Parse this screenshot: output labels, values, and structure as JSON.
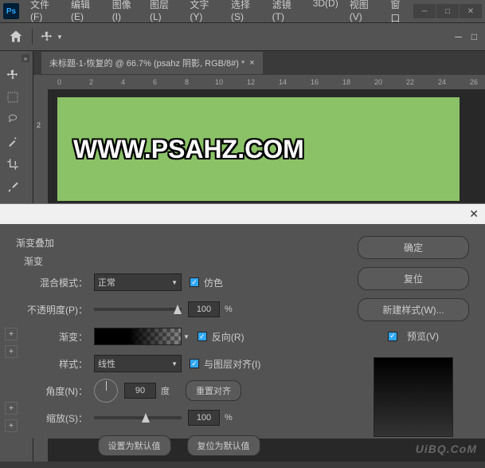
{
  "menubar": [
    "文件(F)",
    "编辑(E)",
    "图像(I)",
    "图层(L)",
    "文字(Y)",
    "选择(S)",
    "滤镜(T)",
    "3D(D)",
    "视图(V)",
    "窗口"
  ],
  "doc_tab": "未标题-1-恢复的 @ 66.7% (psahz 阴影, RGB/8#) *",
  "ruler_ticks": [
    "0",
    "2",
    "4",
    "6",
    "8",
    "10",
    "12",
    "14",
    "16",
    "18",
    "20",
    "22",
    "24",
    "26"
  ],
  "canvas_text": "WWW.PSAHZ.COM",
  "ruler_v": [
    "2"
  ],
  "dialog": {
    "title": "渐变叠加",
    "subtitle": "渐变",
    "blend_mode_label": "混合模式：",
    "blend_mode_value": "正常",
    "dither_label": "仿色",
    "opacity_label": "不透明度(P)：",
    "opacity_value": "100",
    "opacity_unit": "%",
    "gradient_label": "渐变：",
    "reverse_label": "反向(R)",
    "style_label": "样式：",
    "style_value": "线性",
    "align_label": "与图层对齐(I)",
    "angle_label": "角度(N)：",
    "angle_value": "90",
    "angle_unit": "度",
    "reset_align": "重置对齐",
    "scale_label": "缩放(S)：",
    "scale_value": "100",
    "scale_unit": "%",
    "set_default": "设置为默认值",
    "reset_default": "复位为默认值",
    "ok": "确定",
    "cancel": "复位",
    "new_style": "新建样式(W)...",
    "preview": "预览(V)"
  },
  "watermark": "UiBQ.CoM"
}
